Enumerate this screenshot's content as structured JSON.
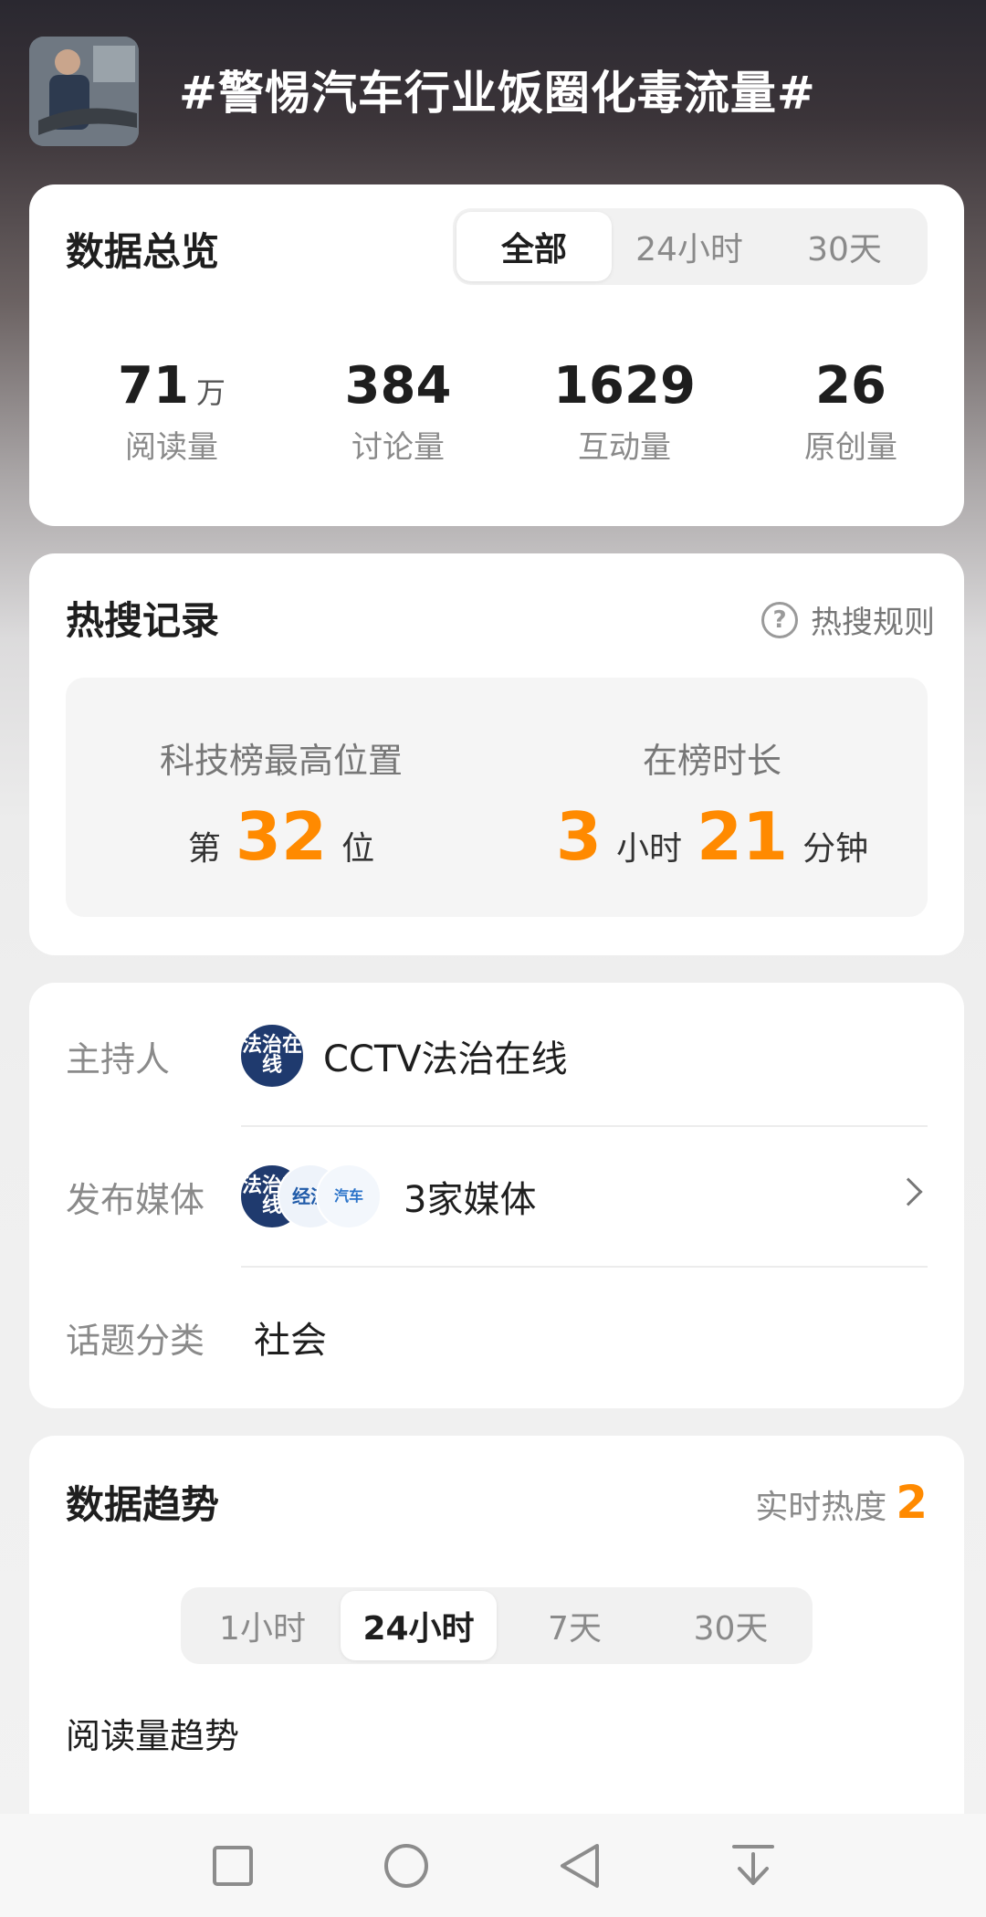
{
  "header": {
    "title": "#警惕汽车行业饭圈化毒流量#"
  },
  "overview": {
    "title": "数据总览",
    "tabs": [
      {
        "label": "全部",
        "active": true
      },
      {
        "label": "24小时",
        "active": false
      },
      {
        "label": "30天",
        "active": false
      }
    ],
    "stats": [
      {
        "value": "71",
        "unit": "万",
        "label": "阅读量"
      },
      {
        "value": "384",
        "unit": "",
        "label": "讨论量"
      },
      {
        "value": "1629",
        "unit": "",
        "label": "互动量"
      },
      {
        "value": "26",
        "unit": "",
        "label": "原创量"
      }
    ]
  },
  "hot": {
    "title": "热搜记录",
    "rule_label": "热搜规则",
    "rank_label": "科技榜最高位置",
    "rank_prefix": "第",
    "rank_value": "32",
    "rank_suffix": "位",
    "duration_label": "在榜时长",
    "hours": "3",
    "hours_unit": "小时",
    "minutes": "21",
    "minutes_unit": "分钟"
  },
  "info": {
    "host_label": "主持人",
    "host_name": "CCTV法治在线",
    "host_avatar_text": "法治在线",
    "media_label": "发布媒体",
    "media_count": "3家媒体",
    "media_avatars": [
      "法治在线",
      "经济",
      "汽车"
    ],
    "category_label": "话题分类",
    "category_value": "社会"
  },
  "trend": {
    "title": "数据趋势",
    "heat_label": "实时热度",
    "heat_value": "2",
    "tabs": [
      {
        "label": "1小时",
        "active": false
      },
      {
        "label": "24小时",
        "active": true
      },
      {
        "label": "7天",
        "active": false
      },
      {
        "label": "30天",
        "active": false
      }
    ],
    "subtitle": "阅读量趋势"
  },
  "navbar": {
    "icons": [
      "square-icon",
      "circle-icon",
      "back-triangle-icon",
      "pull-down-icon"
    ]
  },
  "colors": {
    "accent": "#ff8a00",
    "host_avatar": "#1f3a6e"
  }
}
